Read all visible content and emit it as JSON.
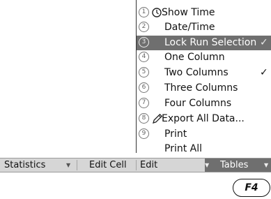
{
  "menu": {
    "items": [
      {
        "num": "1",
        "label": "Show Time",
        "icon": "clock-icon",
        "checked": false,
        "selected": false
      },
      {
        "num": "2",
        "label": "Date/Time",
        "icon": "",
        "checked": false,
        "selected": false
      },
      {
        "num": "3",
        "label": "Lock Run Selection",
        "icon": "",
        "checked": true,
        "selected": true
      },
      {
        "num": "4",
        "label": "One Column",
        "icon": "",
        "checked": false,
        "selected": false
      },
      {
        "num": "5",
        "label": "Two Columns",
        "icon": "",
        "checked": true,
        "selected": false
      },
      {
        "num": "6",
        "label": "Three Columns",
        "icon": "",
        "checked": false,
        "selected": false
      },
      {
        "num": "7",
        "label": "Four Columns",
        "icon": "",
        "checked": false,
        "selected": false
      },
      {
        "num": "8",
        "label": "Export All Data...",
        "icon": "pencil-icon",
        "checked": false,
        "selected": false
      },
      {
        "num": "9",
        "label": "Print",
        "icon": "",
        "checked": false,
        "selected": false
      },
      {
        "num": "",
        "label": "Print All",
        "icon": "",
        "checked": false,
        "selected": false
      }
    ],
    "check_glyph": "✓"
  },
  "toolbar": {
    "tabs": [
      {
        "label": "Statistics",
        "dropdown": true,
        "active": false
      },
      {
        "label": "Edit Cell",
        "dropdown": false,
        "active": false
      },
      {
        "label": "Edit",
        "dropdown": false,
        "active": false
      },
      {
        "label": "Tables",
        "dropdown": true,
        "active": true
      }
    ],
    "dropdown_glyph": "▼"
  },
  "function_key": {
    "label": "F4"
  },
  "colors": {
    "selection": "#6f6f6f",
    "toolbar": "#d6d6d6"
  }
}
